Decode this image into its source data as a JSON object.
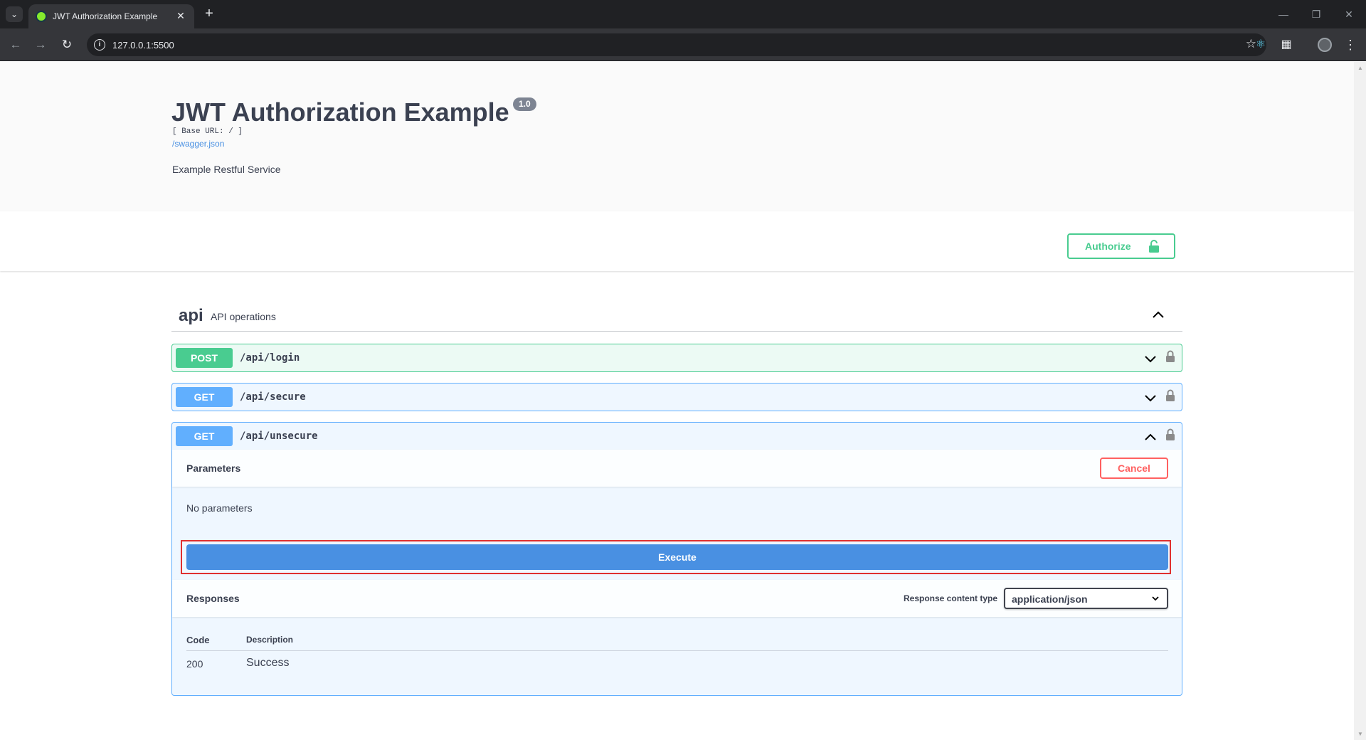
{
  "browser": {
    "tab_title": "JWT Authorization Example",
    "url": "127.0.0.1:5500",
    "icons": {
      "tab_list": "chevron-down-icon",
      "tab_close": "close-icon",
      "new_tab": "plus-icon",
      "back": "arrow-left-icon",
      "forward": "arrow-right-icon",
      "reload": "reload-icon",
      "site_info": "info-icon",
      "bookmark": "star-icon",
      "extensions": "puzzle-icon",
      "menu": "kebab-icon"
    }
  },
  "info": {
    "title": "JWT Authorization Example",
    "version": "1.0",
    "base_url": "[ Base URL: / ]",
    "spec_link": "/swagger.json",
    "description": "Example Restful Service"
  },
  "authorize": {
    "label": "Authorize"
  },
  "tag": {
    "name": "api",
    "description": "API operations"
  },
  "operations": [
    {
      "method": "POST",
      "path": "/api/login",
      "expanded": false
    },
    {
      "method": "GET",
      "path": "/api/secure",
      "expanded": false
    },
    {
      "method": "GET",
      "path": "/api/unsecure",
      "expanded": true
    }
  ],
  "expanded_op": {
    "parameters_title": "Parameters",
    "cancel_label": "Cancel",
    "no_parameters": "No parameters",
    "execute_label": "Execute",
    "responses_title": "Responses",
    "response_content_type_label": "Response content type",
    "response_content_type_value": "application/json",
    "table_headers": [
      "Code",
      "Description"
    ],
    "responses": [
      {
        "code": "200",
        "description": "Success"
      }
    ]
  },
  "colors": {
    "post": "#49cc90",
    "get": "#61affe",
    "execute": "#4990e2",
    "cancel": "#ff6060",
    "highlight": "#e0302f"
  }
}
